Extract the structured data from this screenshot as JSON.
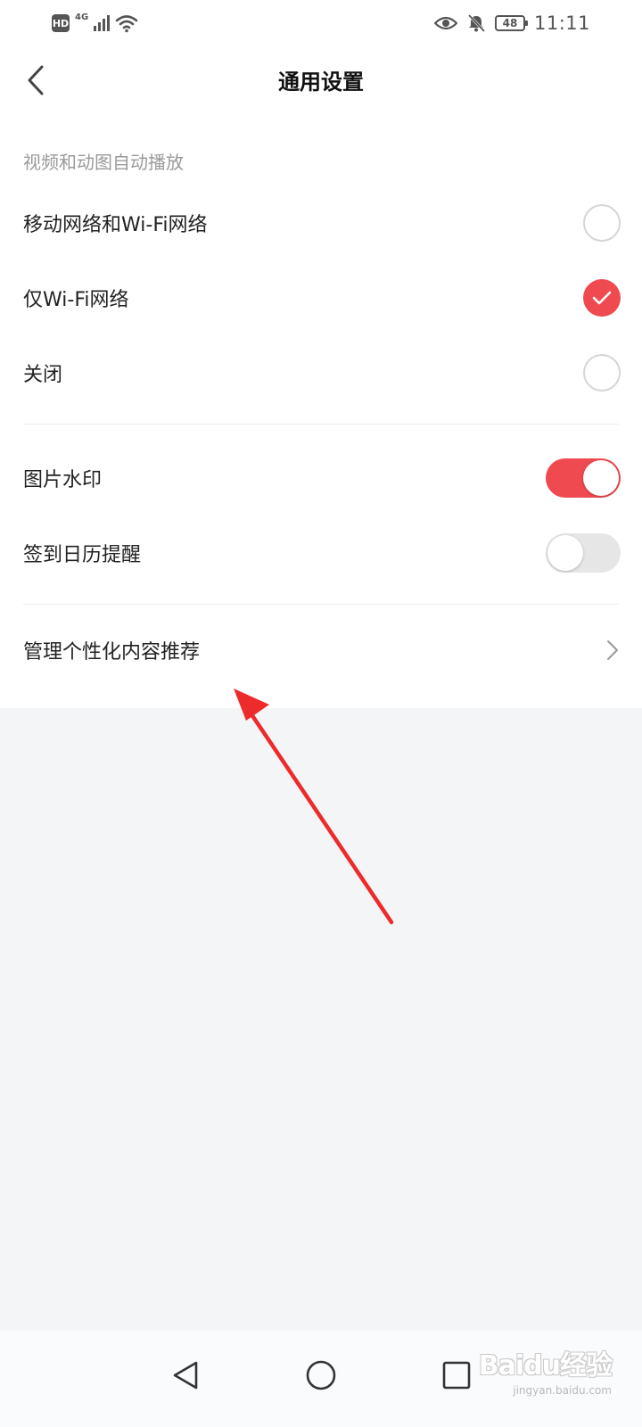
{
  "status_bar": {
    "hd_badge": "HD",
    "network_type": "4G",
    "battery_level": "48",
    "time": "11:11",
    "icons": [
      "hd-badge",
      "signal-icon",
      "wifi-icon",
      "eye-icon",
      "bell-off-icon",
      "battery-icon"
    ]
  },
  "header": {
    "title": "通用设置",
    "back_icon": "chevron-left-icon"
  },
  "autoplay_section": {
    "header": "视频和动图自动播放",
    "options": [
      {
        "label": "移动网络和Wi-Fi网络",
        "selected": false
      },
      {
        "label": "仅Wi-Fi网络",
        "selected": true
      },
      {
        "label": "关闭",
        "selected": false
      }
    ]
  },
  "toggles": [
    {
      "label": "图片水印",
      "on": true
    },
    {
      "label": "签到日历提醒",
      "on": false
    }
  ],
  "links": [
    {
      "label": "管理个性化内容推荐",
      "icon": "chevron-right-icon"
    }
  ],
  "system_nav": {
    "buttons": [
      "back-triangle-icon",
      "home-circle-icon",
      "recents-square-icon"
    ]
  },
  "watermark": {
    "logo_text": "Baidu经验",
    "url_text": "jingyan.baidu.com"
  },
  "colors": {
    "accent": "#ef4a50",
    "annotation_arrow": "#ee2b2b",
    "background": "#f4f5f7",
    "toggle_off": "#e6e6e6",
    "radio_border": "#d6d6d6",
    "section_header": "#9a9a9a"
  }
}
